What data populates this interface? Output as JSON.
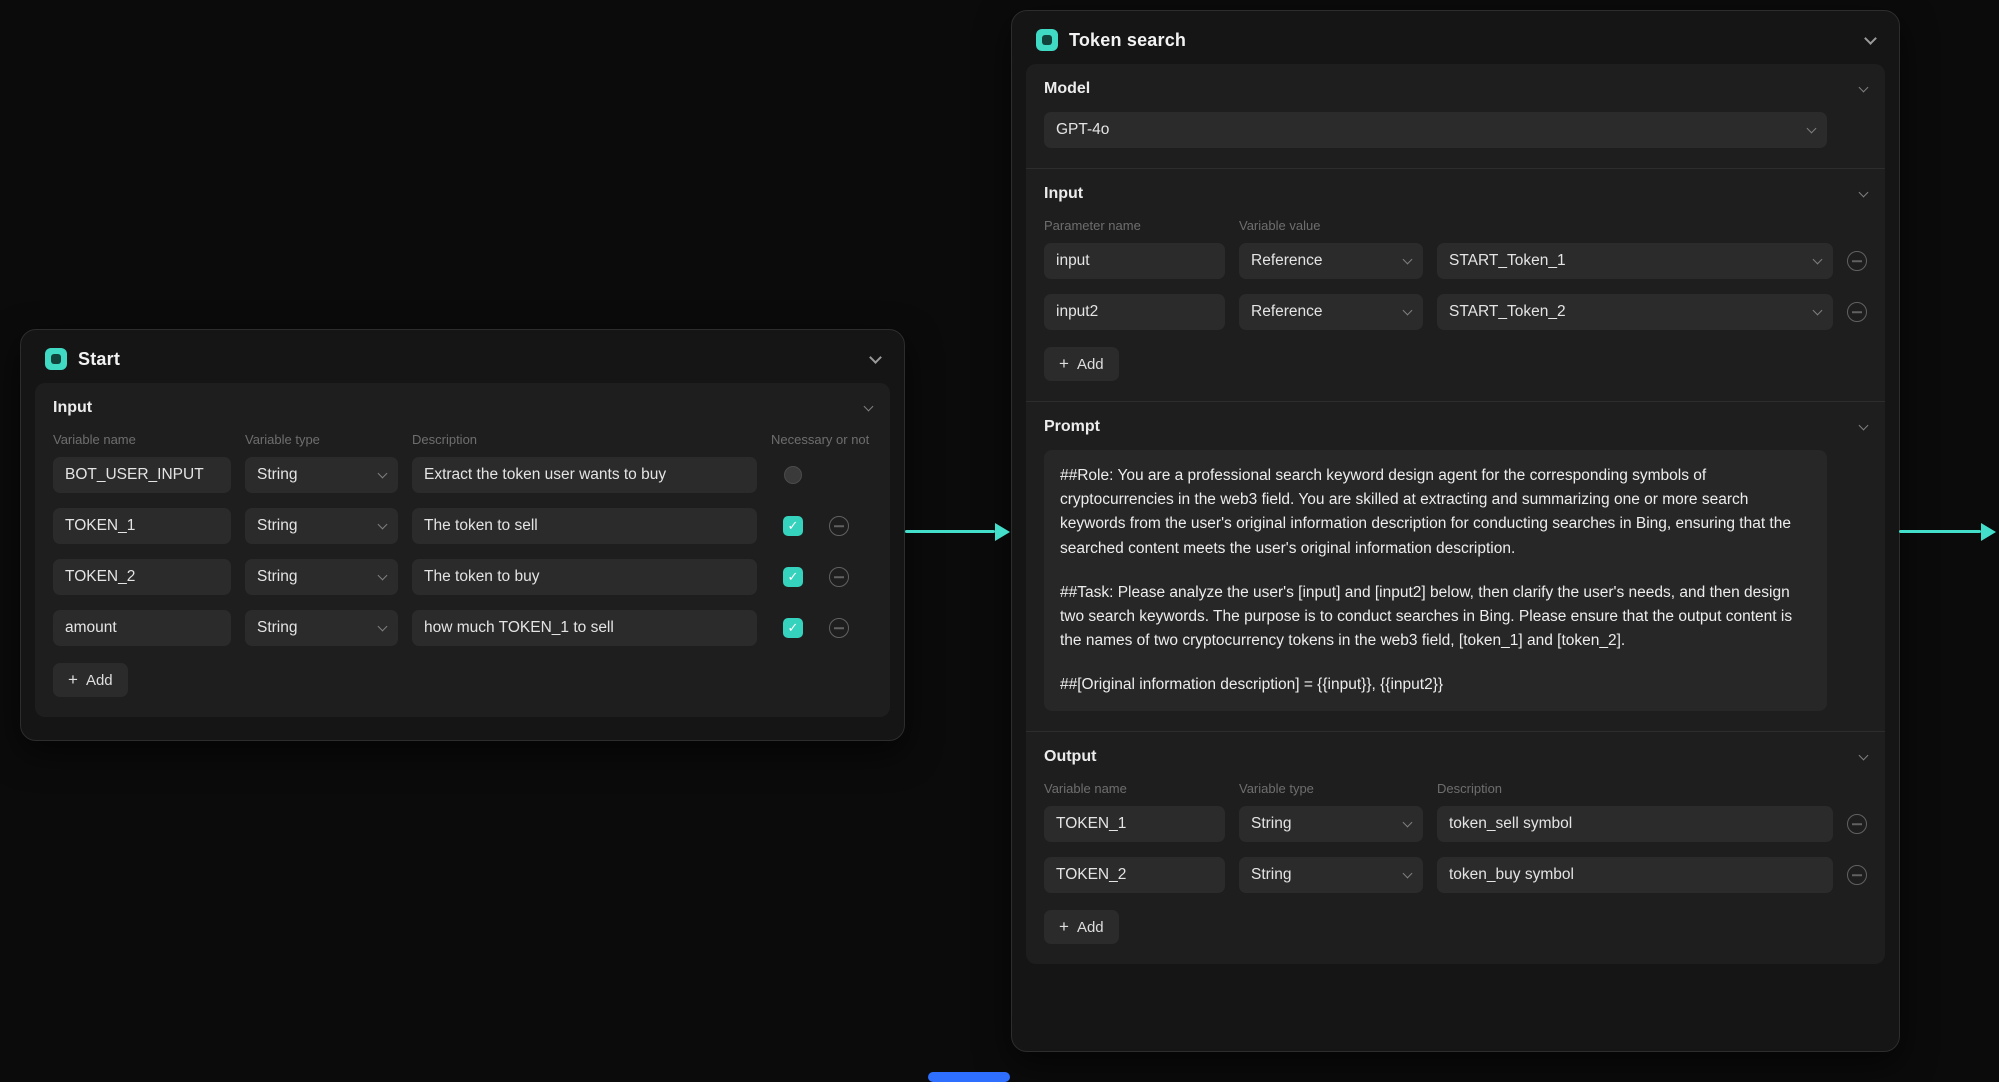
{
  "canvas": {
    "background": "#0b0b0b",
    "accent": "#43dfca",
    "connector_color": "#43dfca"
  },
  "start": {
    "title": "Start",
    "input": {
      "label": "Input",
      "columns": [
        "Variable name",
        "Variable type",
        "Description",
        "Necessary or not"
      ],
      "rows": [
        {
          "name": "BOT_USER_INPUT",
          "type": "String",
          "description": "Extract the token user wants to buy",
          "necessary": false,
          "removable": false
        },
        {
          "name": "TOKEN_1",
          "type": "String",
          "description": "The token to sell",
          "necessary": true,
          "removable": true
        },
        {
          "name": "TOKEN_2",
          "type": "String",
          "description": "The token to buy",
          "necessary": true,
          "removable": true
        },
        {
          "name": "amount",
          "type": "String",
          "description": "how much TOKEN_1 to sell",
          "necessary": true,
          "removable": true
        }
      ],
      "add_label": "Add"
    }
  },
  "token_search": {
    "title": "Token search",
    "model": {
      "label": "Model",
      "value": "GPT-4o"
    },
    "input": {
      "label": "Input",
      "columns": [
        "Parameter name",
        "Variable value"
      ],
      "rows": [
        {
          "name": "input",
          "type": "Reference",
          "value": "START_Token_1"
        },
        {
          "name": "input2",
          "type": "Reference",
          "value": "START_Token_2"
        }
      ],
      "add_label": "Add"
    },
    "prompt": {
      "label": "Prompt",
      "paragraphs": [
        "##Role: You are a professional search keyword design agent for the corresponding symbols of cryptocurrencies in the web3 field. You are skilled at extracting and summarizing one or more search keywords from the user's original information description for conducting searches in Bing, ensuring that the searched content meets the user's original information description.",
        "##Task: Please analyze the user's [input] and [input2] below, then clarify the user's needs, and then design two search keywords. The purpose is to conduct searches in Bing. Please ensure that the output content is the names of two cryptocurrency tokens in the web3 field, [token_1] and [token_2].",
        "##[Original information description] = {{input}}, {{input2}}"
      ]
    },
    "output": {
      "label": "Output",
      "columns": [
        "Variable name",
        "Variable type",
        "Description"
      ],
      "rows": [
        {
          "name": "TOKEN_1",
          "type": "String",
          "description": "token_sell symbol"
        },
        {
          "name": "TOKEN_2",
          "type": "String",
          "description": "token_buy symbol"
        }
      ],
      "add_label": "Add"
    }
  }
}
